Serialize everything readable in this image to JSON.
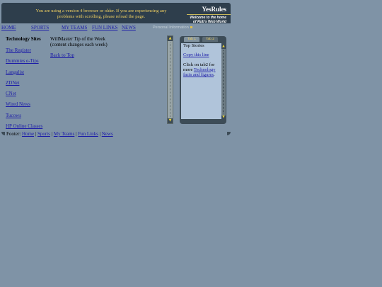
{
  "header": {
    "notice": "You are using a version 4 browser or older. If you are experiencing any problems with scrolling, please reload the page.",
    "brand": "YesRules",
    "tagline_line1": "Welcome to the home",
    "tagline_line2": "of Rob's Web World"
  },
  "nav": {
    "items": [
      "HOME",
      "SPORTS",
      "MY TEAMS",
      "FUN LINKS",
      "NEWS"
    ],
    "personal_info": "Personal Information"
  },
  "sidebar": {
    "title": "Technology Sites",
    "links": [
      "The Register",
      "Dummies e-Tips",
      "Langalist",
      "ZDNet",
      "CNet",
      "Wired News",
      "Tucows",
      "HP Online Classes"
    ]
  },
  "main": {
    "tip_line1": "WillMaster Tip of the Week",
    "tip_line2": "(content changes each week)",
    "back_to_top": "Back to Top"
  },
  "tabbox": {
    "tabs": [
      "Tab 1",
      "Tab 2"
    ],
    "active_tab": "Tab 1",
    "heading": "Top Stories",
    "copy_link": "Copy this line",
    "click_prefix": "Click on tab2 for more ",
    "click_link": "Technology facts and figures",
    "click_suffix": "."
  },
  "footer": {
    "label": "Footer:",
    "links": [
      "Home",
      "Sports",
      "My Teams",
      "Fun Links",
      "News"
    ],
    "separator": " | "
  },
  "icons": {
    "scroll_up": "arrow-up-icon",
    "scroll_down": "arrow-down-icon"
  }
}
